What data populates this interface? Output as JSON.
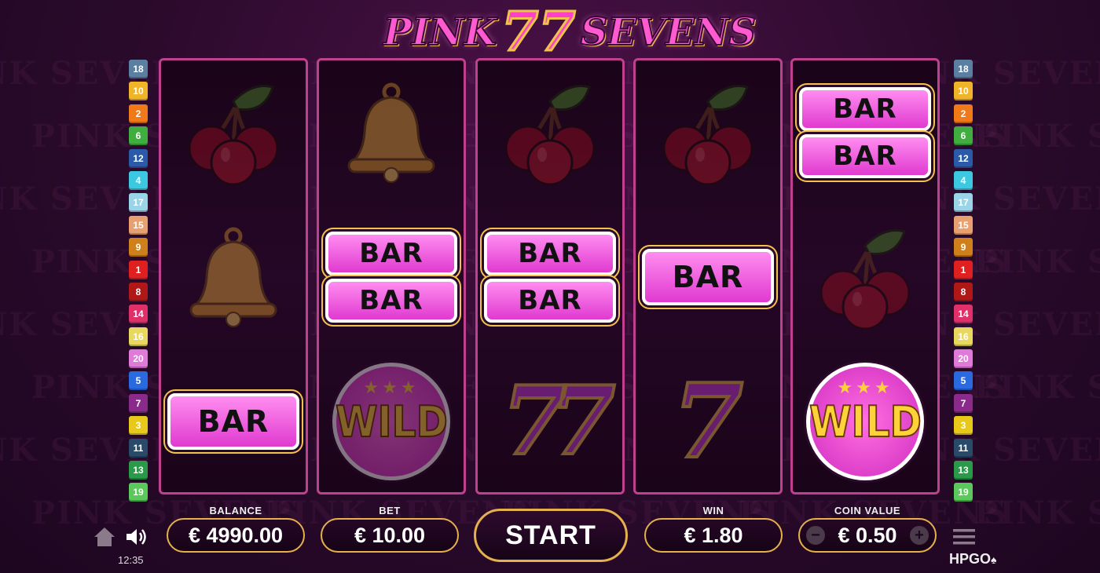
{
  "title": {
    "left_word": "PINK",
    "center_sevens": "77",
    "right_word": "SEVENS"
  },
  "background_watermark": "PINK SEVENS",
  "paylines_left": [
    {
      "n": "18",
      "color": "#5a7fa0"
    },
    {
      "n": "10",
      "color": "#f0b429"
    },
    {
      "n": "2",
      "color": "#f07a1a"
    },
    {
      "n": "6",
      "color": "#3fae3f"
    },
    {
      "n": "12",
      "color": "#2a5aa8"
    },
    {
      "n": "4",
      "color": "#3cc8e0"
    },
    {
      "n": "17",
      "color": "#9ad4e8"
    },
    {
      "n": "15",
      "color": "#e8a070"
    },
    {
      "n": "9",
      "color": "#d0801a"
    },
    {
      "n": "1",
      "color": "#e02020"
    },
    {
      "n": "8",
      "color": "#b01818"
    },
    {
      "n": "14",
      "color": "#e0306a"
    },
    {
      "n": "16",
      "color": "#e8d860"
    },
    {
      "n": "20",
      "color": "#e07ad8"
    },
    {
      "n": "5",
      "color": "#2a6ae0"
    },
    {
      "n": "7",
      "color": "#8a2a8a"
    },
    {
      "n": "3",
      "color": "#e8c81a"
    },
    {
      "n": "11",
      "color": "#2a4a6a"
    },
    {
      "n": "13",
      "color": "#2a9a4a"
    },
    {
      "n": "19",
      "color": "#5ac85a"
    }
  ],
  "paylines_right": [
    {
      "n": "18",
      "color": "#5a7fa0"
    },
    {
      "n": "10",
      "color": "#f0b429"
    },
    {
      "n": "2",
      "color": "#f07a1a"
    },
    {
      "n": "6",
      "color": "#3fae3f"
    },
    {
      "n": "12",
      "color": "#2a5aa8"
    },
    {
      "n": "4",
      "color": "#3cc8e0"
    },
    {
      "n": "17",
      "color": "#9ad4e8"
    },
    {
      "n": "15",
      "color": "#e8a070"
    },
    {
      "n": "9",
      "color": "#d0801a"
    },
    {
      "n": "1",
      "color": "#e02020"
    },
    {
      "n": "8",
      "color": "#b01818"
    },
    {
      "n": "14",
      "color": "#e0306a"
    },
    {
      "n": "16",
      "color": "#e8d860"
    },
    {
      "n": "20",
      "color": "#e07ad8"
    },
    {
      "n": "5",
      "color": "#2a6ae0"
    },
    {
      "n": "7",
      "color": "#8a2a8a"
    },
    {
      "n": "3",
      "color": "#e8c81a"
    },
    {
      "n": "11",
      "color": "#2a4a6a"
    },
    {
      "n": "13",
      "color": "#2a9a4a"
    },
    {
      "n": "19",
      "color": "#5ac85a"
    }
  ],
  "reels": [
    [
      "cherry",
      "bell",
      "bar"
    ],
    [
      "bell",
      "double-bar",
      "wild"
    ],
    [
      "cherry",
      "double-bar",
      "double-seven"
    ],
    [
      "cherry",
      "bar",
      "seven"
    ],
    [
      "double-bar",
      "cherry",
      "wild"
    ]
  ],
  "symbol_text": {
    "bar": "BAR",
    "wild": "WILD",
    "seven": "7",
    "double_seven": "77",
    "stars": "★★★"
  },
  "controls": {
    "balance_label": "BALANCE",
    "balance_value": "€ 4990.00",
    "bet_label": "BET",
    "bet_value": "€ 10.00",
    "start_label": "START",
    "win_label": "WIN",
    "win_value": "€ 1.80",
    "coin_label": "COIN VALUE",
    "coin_value": "€ 0.50",
    "minus": "−",
    "plus": "+"
  },
  "clock": "12:35",
  "brand": "HPGO",
  "colors": {
    "accent": "#ff5ad0",
    "gold": "#e5b14d",
    "reel_border": "#c0408f"
  }
}
